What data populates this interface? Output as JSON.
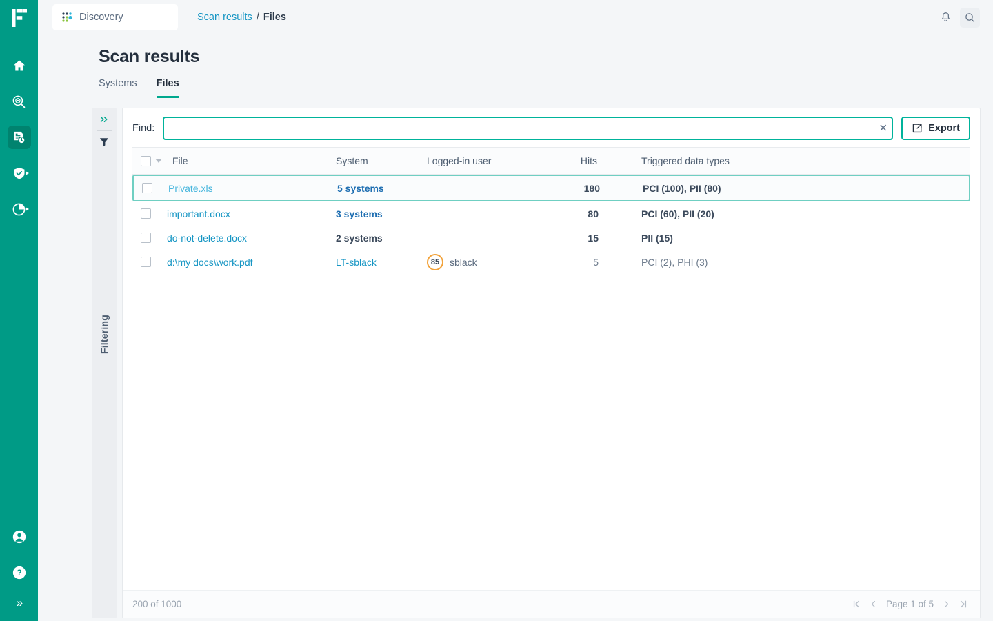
{
  "brand": {
    "rail_color": "#009b86",
    "accent": "#00b39b",
    "link": "#1796c4"
  },
  "topbar": {
    "product_name": "Discovery",
    "product_icon": "dot-grid-icon",
    "breadcrumb": {
      "parent": "Scan results",
      "separator": "/",
      "current": "Files"
    },
    "notifications_icon": "bell-icon",
    "search_icon": "search-icon"
  },
  "rail": {
    "logo": "f-logo",
    "items": [
      {
        "name": "home",
        "icon": "home-icon",
        "active": false,
        "expandable": false
      },
      {
        "name": "discover",
        "icon": "magnifier-target-icon",
        "active": false,
        "expandable": false
      },
      {
        "name": "scan-results",
        "icon": "document-clock-icon",
        "active": true,
        "expandable": false
      },
      {
        "name": "protection",
        "icon": "shield-check-icon",
        "active": false,
        "expandable": true
      },
      {
        "name": "reports",
        "icon": "pie-chart-icon",
        "active": false,
        "expandable": true
      }
    ],
    "bottom": [
      {
        "name": "account",
        "icon": "user-circle-icon"
      },
      {
        "name": "help",
        "icon": "question-circle-icon"
      }
    ],
    "expand_label": "»"
  },
  "page": {
    "title": "Scan results",
    "tabs": [
      {
        "label": "Systems",
        "active": false
      },
      {
        "label": "Files",
        "active": true
      }
    ]
  },
  "filter_strip": {
    "collapse_icon": "double-chevron-right-icon",
    "filter_icon": "funnel-icon",
    "vertical_label": "Filtering"
  },
  "toolbar": {
    "find_label": "Find:",
    "find_value": "",
    "find_placeholder": "",
    "clear_icon": "close-icon",
    "export_label": "Export",
    "export_icon": "export-icon"
  },
  "table": {
    "columns": [
      "File",
      "System",
      "Logged-in user",
      "Hits",
      "Triggered data types"
    ],
    "select_all_checked": false,
    "sort_caret": "caret-down-icon",
    "rows": [
      {
        "file": "Private.xls",
        "system": "5 systems",
        "system_style": "bold-blue",
        "user": "",
        "user_score": "",
        "hits": "180",
        "types": "PCI (100), PII (80)",
        "selected": true,
        "emphasis": "bold"
      },
      {
        "file": "important.docx",
        "system": "3 systems",
        "system_style": "bold-blue",
        "user": "",
        "user_score": "",
        "hits": "80",
        "types": "PCI (60), PII (20)",
        "selected": false,
        "emphasis": "bold"
      },
      {
        "file": "do-not-delete.docx",
        "system": "2 systems",
        "system_style": "bold-dark",
        "user": "",
        "user_score": "",
        "hits": "15",
        "types": "PII (15)",
        "selected": false,
        "emphasis": "bold"
      },
      {
        "file": "d:\\my docs\\work.pdf",
        "system": "LT-sblack",
        "system_style": "link",
        "user": "sblack",
        "user_score": "85",
        "hits": "5",
        "types": "PCI (2), PHI (3)",
        "selected": false,
        "emphasis": "normal"
      }
    ]
  },
  "footer": {
    "count_text": "200 of 1000",
    "page_label": "Page 1 of 5",
    "first_icon": "page-first-icon",
    "prev_icon": "page-prev-icon",
    "next_icon": "page-next-icon",
    "last_icon": "page-last-icon"
  }
}
